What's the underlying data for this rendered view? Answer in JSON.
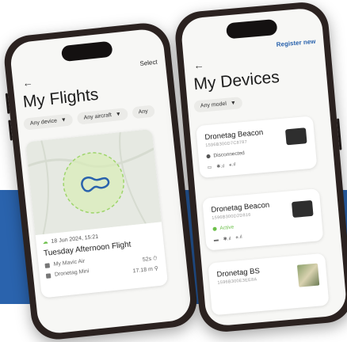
{
  "colors": {
    "accent": "#2a63ad",
    "active": "#6cc04a",
    "disconnected": "#555555",
    "route": "#2a63ad",
    "geofence": "#9ed56b"
  },
  "flights_screen": {
    "title": "My Flights",
    "select_label": "Select",
    "back_icon": "arrow-left-icon",
    "filters": [
      {
        "label": "Any device"
      },
      {
        "label": "Any aircraft"
      },
      {
        "label": "Any"
      }
    ],
    "flight": {
      "date": "18 Jun 2024, 15:21",
      "title": "Tuesday Afternoon Flight",
      "aircraft": "My Mavic Air",
      "device": "Dronetag Mini",
      "duration": "52s",
      "distance": "17.18 m"
    }
  },
  "devices_screen": {
    "title": "My Devices",
    "register_label": "Register new",
    "back_icon": "arrow-left-icon",
    "filter": {
      "label": "Any model"
    },
    "devices": [
      {
        "name": "Dronetag Beacon",
        "serial": "1596B300D7C8787",
        "status": "Disconnected"
      },
      {
        "name": "Dronetag Beacon",
        "serial": "1596B300D2D816",
        "status": "Active"
      },
      {
        "name": "Dronetag BS",
        "serial": "1596B300E3EE8A"
      }
    ]
  }
}
